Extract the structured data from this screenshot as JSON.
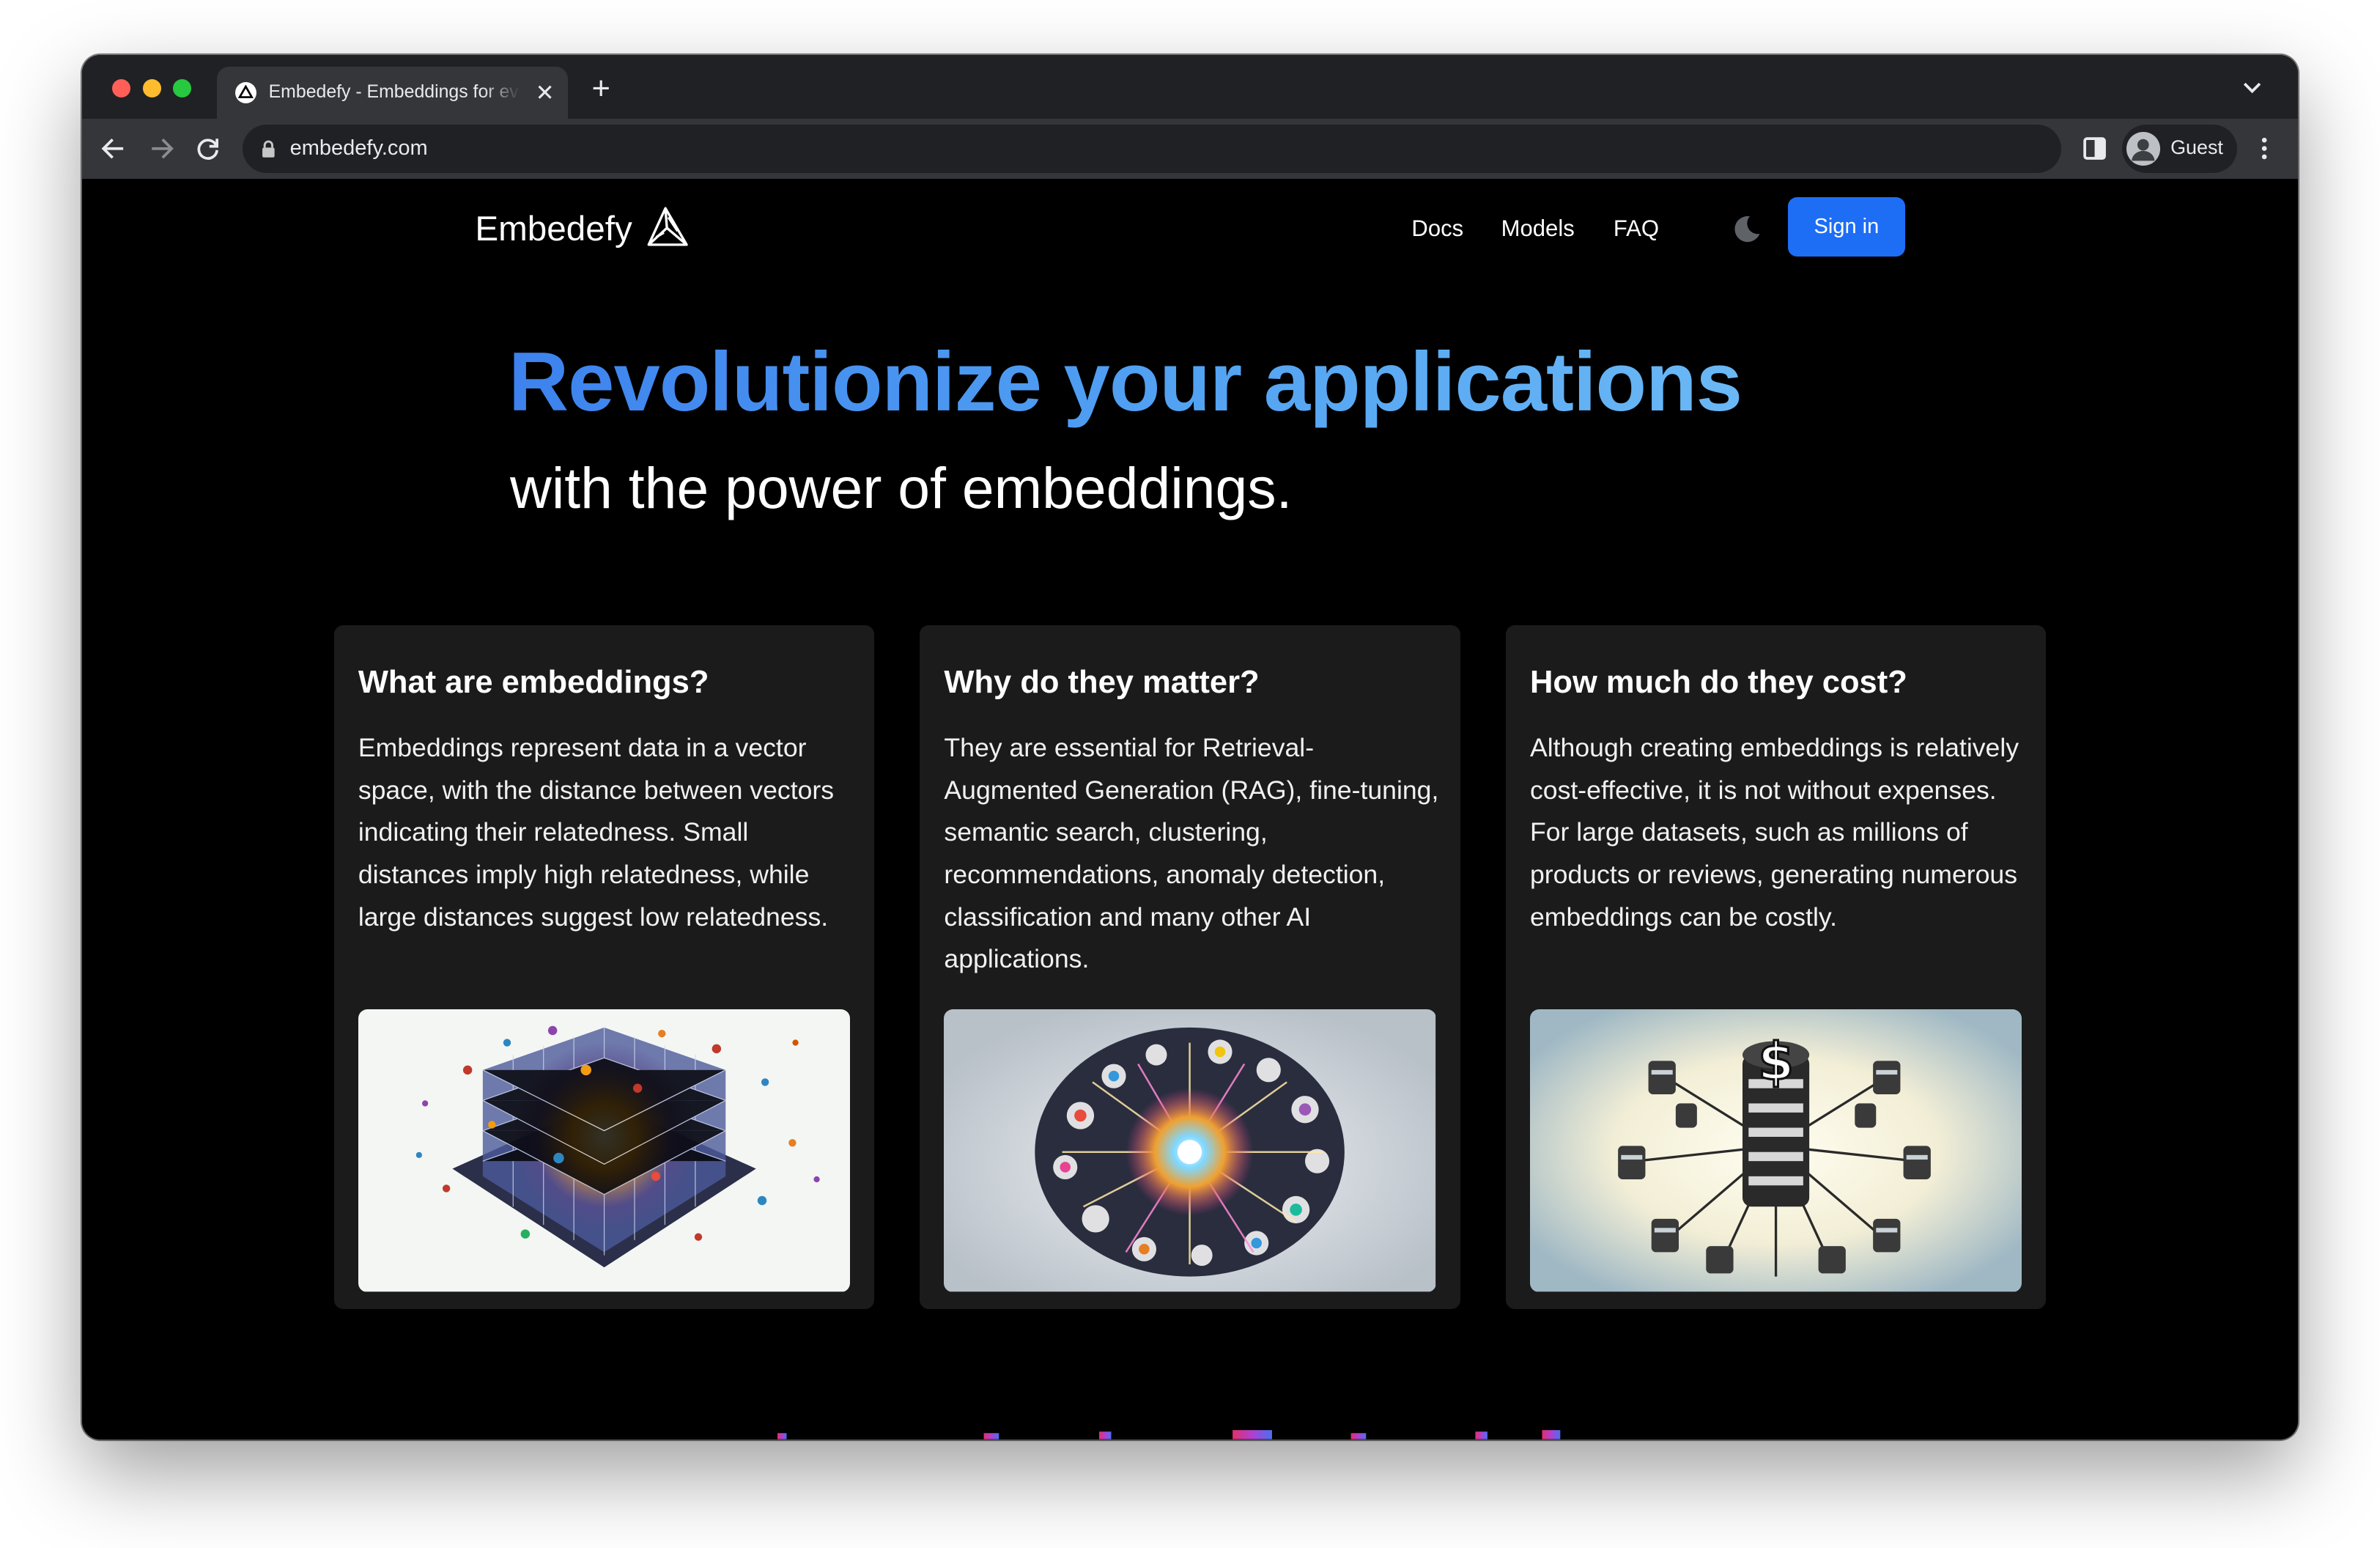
{
  "browser": {
    "tab_title": "Embedefy - Embeddings for everyone",
    "url": "embedefy.com",
    "profile_name": "Guest",
    "icons": [
      "close-icon",
      "plus-icon",
      "chevron-down-icon",
      "back-arrow-icon",
      "forward-arrow-icon",
      "reload-icon",
      "lock-icon",
      "side-panel-icon",
      "avatar-icon",
      "more-vert-icon"
    ]
  },
  "header": {
    "brand": "Embedefy",
    "nav": [
      "Docs",
      "Models",
      "FAQ"
    ],
    "signin_label": "Sign in",
    "theme_icon": "moon-icon"
  },
  "hero": {
    "title": "Revolutionize your applications",
    "subtitle": "with the power of embeddings."
  },
  "cards": [
    {
      "title": "What are embeddings?",
      "body": "Embeddings represent data in a vector space, with the distance between vectors indicating their relatedness. Small distances imply high relatedness, while large distances suggest low relatedness."
    },
    {
      "title": "Why do they matter?",
      "body": "They are essential for Retrieval-Augmented Generation (RAG), fine-tuning, semantic search, clustering, recommendations, anomaly detection, classification and many other AI applications."
    },
    {
      "title": "How much do they cost?",
      "body": "Although creating embeddings is relatively cost-effective, it is not without expenses. For large datasets, such as millions of products or reviews, generating numerous embeddings can be costly."
    }
  ],
  "colors": {
    "accent": "#1d6ef5",
    "hero_gradient": [
      "#3d82ee",
      "#6ab8f5"
    ],
    "card_bg": "#1b1b1c",
    "page_bg": "#000000"
  }
}
